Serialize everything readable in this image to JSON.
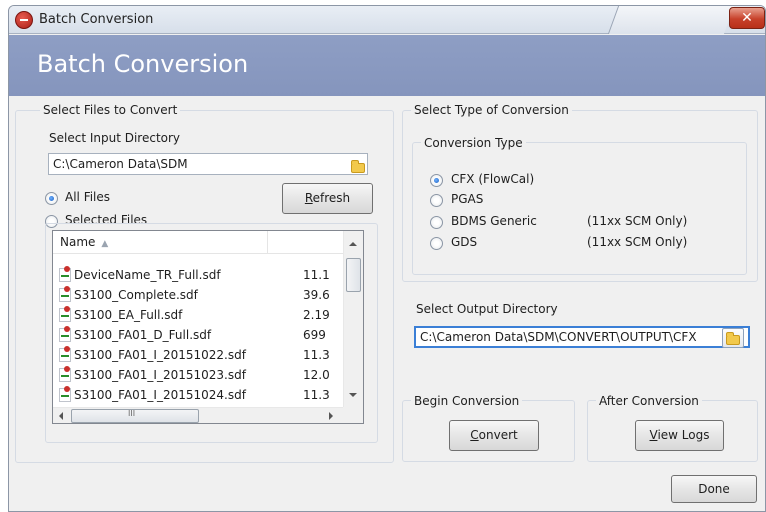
{
  "window": {
    "title": "Batch Conversion"
  },
  "header": {
    "title": "Batch Conversion"
  },
  "select_files": {
    "group_label": "Select Files to Convert",
    "input_dir_label": "Select Input Directory",
    "input_dir_value": "C:\\Cameron Data\\SDM",
    "radio_all": "All Files",
    "radio_selected": "Selected Files",
    "refresh_prefix": "",
    "refresh_mnemonic": "R",
    "refresh_rest": "efresh",
    "list": {
      "column_name": "Name",
      "rows": [
        {
          "name": "DeviceName_TR_Full.sdf",
          "size": "11.1"
        },
        {
          "name": "S3100_Complete.sdf",
          "size": "39.6"
        },
        {
          "name": "S3100_EA_Full.sdf",
          "size": "2.19"
        },
        {
          "name": "S3100_FA01_D_Full.sdf",
          "size": "699"
        },
        {
          "name": "S3100_FA01_I_20151022.sdf",
          "size": "11.3"
        },
        {
          "name": "S3100_FA01_I_20151023.sdf",
          "size": "12.0"
        },
        {
          "name": "S3100_FA01_I_20151024.sdf",
          "size": "11.3"
        }
      ]
    }
  },
  "conversion_type": {
    "outer_label": "Select Type of Conversion",
    "inner_label": "Conversion Type",
    "options": [
      {
        "label": "CFX (FlowCal)",
        "note": ""
      },
      {
        "label": "PGAS",
        "note": ""
      },
      {
        "label": "BDMS Generic",
        "note": "(11xx SCM Only)"
      },
      {
        "label": "GDS",
        "note": "(11xx SCM Only)"
      }
    ],
    "selected": "CFX (FlowCal)"
  },
  "output": {
    "label": "Select Output Directory",
    "value": "C:\\Cameron Data\\SDM\\CONVERT\\OUTPUT\\CFX"
  },
  "begin": {
    "label": "Begin Conversion",
    "btn_mnemonic": "C",
    "btn_rest": "onvert"
  },
  "after": {
    "label": "After Conversion",
    "btn_mnemonic": "V",
    "btn_rest": "iew Logs"
  },
  "footer": {
    "done_label": "Done"
  },
  "colors": {
    "header_bg": "#8e9ec4",
    "close_red": "#c7412a",
    "active_border": "#3b7fd6"
  }
}
